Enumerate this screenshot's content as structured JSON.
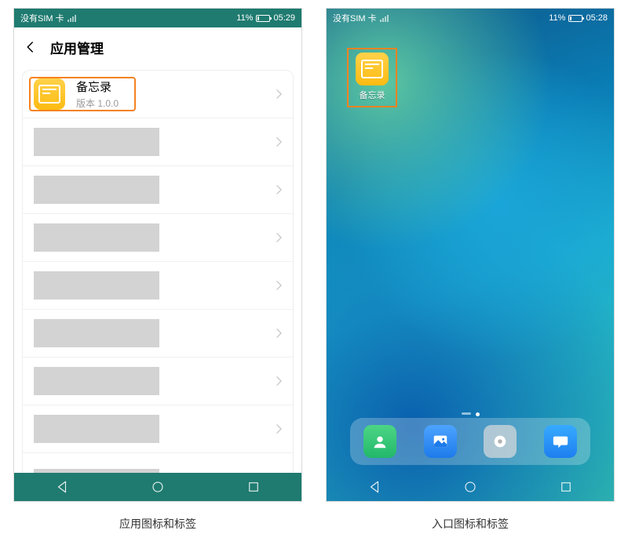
{
  "status": {
    "sim_text": "没有SIM 卡",
    "battery_pct": "11%",
    "time_left": "05:29",
    "time_right": "05:28"
  },
  "left": {
    "title": "应用管理",
    "app_name": "备忘录",
    "app_version": "版本 1.0.0"
  },
  "right": {
    "app_label": "备忘录"
  },
  "dock": {
    "contacts": "contacts-icon",
    "gallery": "gallery-icon",
    "settings": "settings-icon",
    "messages": "messages-icon"
  },
  "captions": {
    "left": "应用图标和标签",
    "right": "入口图标和标签"
  }
}
